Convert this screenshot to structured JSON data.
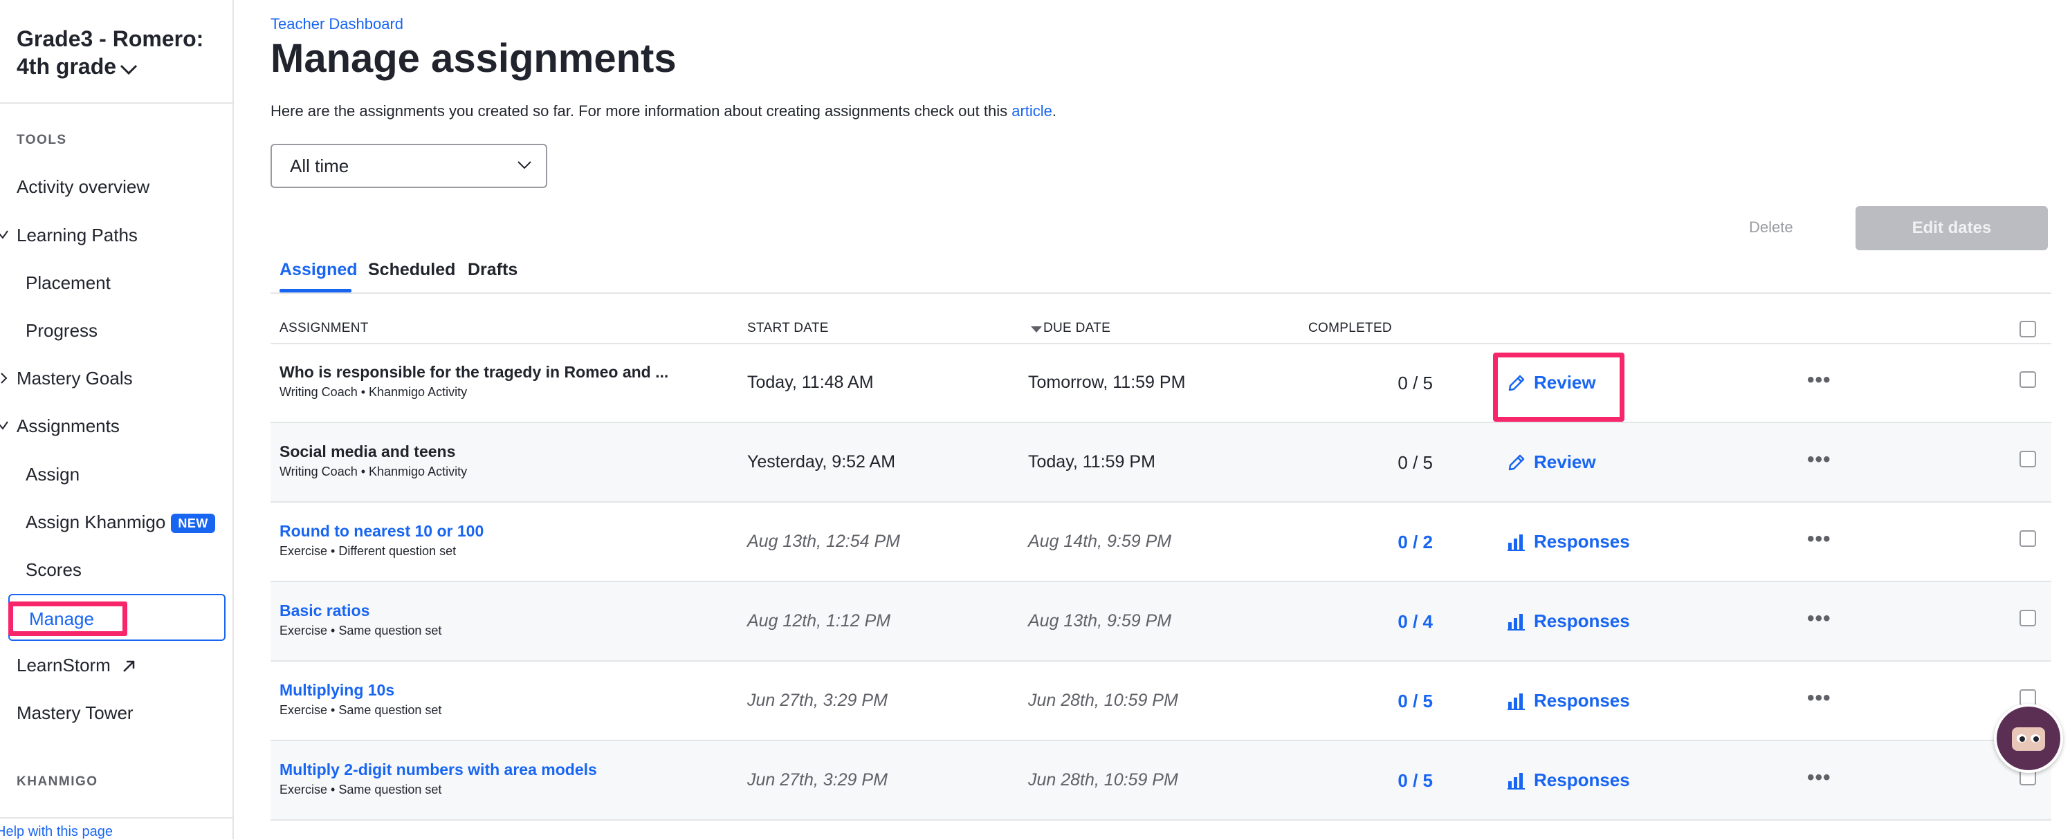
{
  "sidebar": {
    "class_title": "Grade3 - Romero: 4th grade",
    "tools_heading": "TOOLS",
    "items": {
      "activity_overview": "Activity overview",
      "learning_paths": "Learning Paths",
      "placement": "Placement",
      "progress": "Progress",
      "mastery_goals": "Mastery Goals",
      "assignments": "Assignments",
      "assign": "Assign",
      "assign_khanmigo": "Assign Khanmigo",
      "new_badge": "NEW",
      "scores": "Scores",
      "manage": "Manage",
      "learnstorm": "LearnStorm",
      "mastery_tower": "Mastery Tower"
    },
    "khanmigo_heading": "KHANMIGO",
    "help_link": "Help with this page"
  },
  "main": {
    "breadcrumb": "Teacher Dashboard",
    "title": "Manage assignments",
    "intro_text": "Here are the assignments you created so far. For more information about creating assignments check out this",
    "intro_link": "article",
    "intro_end": ".",
    "time_filter": "All time",
    "delete_label": "Delete",
    "edit_dates_label": "Edit dates",
    "tabs": {
      "assigned": "Assigned",
      "scheduled": "Scheduled",
      "drafts": "Drafts"
    },
    "columns": {
      "assignment": "ASSIGNMENT",
      "start_date": "START DATE",
      "due_date": "DUE DATE",
      "completed": "COMPLETED"
    },
    "rows": [
      {
        "title": "Who is responsible for the tragedy in Romeo and ...",
        "subtitle": "Writing Coach • Khanmigo Activity",
        "start": "Today, 11:48 AM",
        "due": "Tomorrow, 11:59 PM",
        "completed": "0 / 5",
        "action": "Review",
        "more": "•••"
      },
      {
        "title": "Social media and teens",
        "subtitle": "Writing Coach • Khanmigo Activity",
        "start": "Yesterday, 9:52 AM",
        "due": "Today, 11:59 PM",
        "completed": "0 / 5",
        "action": "Review",
        "more": "•••"
      },
      {
        "title": "Round to nearest 10 or 100",
        "subtitle": "Exercise • Different question set",
        "start": "Aug 13th, 12:54 PM",
        "due": "Aug 14th, 9:59 PM",
        "completed": "0 / 2",
        "action": "Responses",
        "more": "•••"
      },
      {
        "title": "Basic ratios",
        "subtitle": "Exercise • Same question set",
        "start": "Aug 12th, 1:12 PM",
        "due": "Aug 13th, 9:59 PM",
        "completed": "0 / 4",
        "action": "Responses",
        "more": "•••"
      },
      {
        "title": "Multiplying 10s",
        "subtitle": "Exercise • Same question set",
        "start": "Jun 27th, 3:29 PM",
        "due": "Jun 28th, 10:59 PM",
        "completed": "0 / 5",
        "action": "Responses",
        "more": "•••"
      },
      {
        "title": "Multiply 2-digit numbers with area models",
        "subtitle": "Exercise • Same question set",
        "start": "Jun 27th, 3:29 PM",
        "due": "Jun 28th, 10:59 PM",
        "completed": "0 / 5",
        "action": "Responses",
        "more": "•••"
      }
    ]
  },
  "colors": {
    "accent": "#1865f2",
    "highlight": "#f7266b",
    "text": "#21242c",
    "muted": "#5f6167"
  },
  "icons": [
    "chevron-down-icon",
    "checkmark-icon",
    "chevron-right-icon",
    "external-link-icon",
    "sort-down-icon",
    "pencil-icon",
    "bar-chart-icon",
    "more-icon",
    "khanmigo-avatar-icon"
  ]
}
